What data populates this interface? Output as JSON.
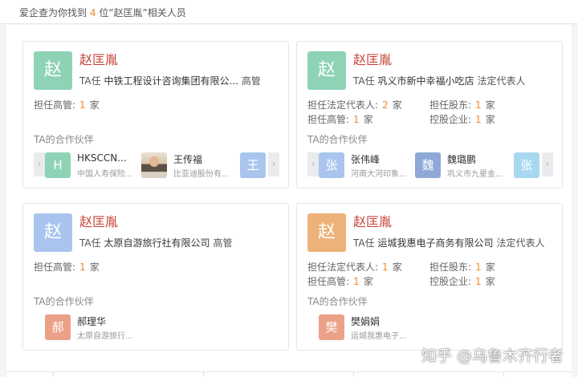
{
  "header": {
    "prefix": "爱企查为你找到",
    "count": "4",
    "suffix": "位“赵匡胤”相关人员"
  },
  "colors": {
    "accent_name": "#c7463b",
    "count_orange": "#f0892f",
    "avatar_teal": "#8ed3b6",
    "avatar_blue": "#a9c5ee",
    "avatar_orange": "#edb27a",
    "avatar_salmon": "#eba187",
    "avatar_steelblue": "#8ea9d6",
    "avatar_cyan": "#a7d8f0"
  },
  "cards": [
    {
      "avatar_char": "赵",
      "name": "赵匡胤",
      "role_prefix": "TA任",
      "company": "中铁工程设计咨询集团有限公...",
      "tag": "高管",
      "stats": [
        {
          "label": "担任高管:",
          "count": "1",
          "unit": "家"
        }
      ],
      "partner_title": "TA的合作伙伴",
      "has_arrows": true,
      "partners": [
        {
          "avatar_char": "H",
          "name": "HKSCCN...",
          "company": "中国人寿保险..."
        },
        {
          "avatar_char": "",
          "name": "王传福",
          "company": "比亚迪股份有..."
        }
      ],
      "partial_char": "王"
    },
    {
      "avatar_char": "赵",
      "name": "赵匡胤",
      "role_prefix": "TA任",
      "company": "巩义市新中幸福小吃店",
      "tag": "法定代表人",
      "stats": [
        {
          "label": "担任法定代表人:",
          "count": "2",
          "unit": "家"
        },
        {
          "label": "担任股东:",
          "count": "1",
          "unit": "家"
        },
        {
          "label": "担任高管:",
          "count": "1",
          "unit": "家"
        },
        {
          "label": "控股企业:",
          "count": "1",
          "unit": "家"
        }
      ],
      "partner_title": "TA的合作伙伴",
      "has_arrows": true,
      "partners": [
        {
          "avatar_char": "张",
          "name": "张伟峰",
          "company": "河南大河印象..."
        },
        {
          "avatar_char": "魏",
          "name": "魏璐鹏",
          "company": "巩义市九星金..."
        }
      ],
      "partial_char": "张"
    },
    {
      "avatar_char": "赵",
      "name": "赵匡胤",
      "role_prefix": "TA任",
      "company": "太原自游旅行社有限公司",
      "tag": "高管",
      "stats": [
        {
          "label": "担任高管:",
          "count": "1",
          "unit": "家"
        }
      ],
      "partner_title": "TA的合作伙伴",
      "has_arrows": false,
      "partners": [
        {
          "avatar_char": "郝",
          "name": "郝理华",
          "company": "太原自游旅行..."
        }
      ]
    },
    {
      "avatar_char": "赵",
      "name": "赵匡胤",
      "role_prefix": "TA任",
      "company": "运城我惠电子商务有限公司",
      "tag": "法定代表人",
      "stats": [
        {
          "label": "担任法定代表人:",
          "count": "1",
          "unit": "家"
        },
        {
          "label": "担任股东:",
          "count": "1",
          "unit": "家"
        },
        {
          "label": "担任高管:",
          "count": "1",
          "unit": "家"
        },
        {
          "label": "控股企业:",
          "count": "1",
          "unit": "家"
        }
      ],
      "partner_title": "TA的合作伙伴",
      "has_arrows": false,
      "partners": [
        {
          "avatar_char": "樊",
          "name": "樊娟娟",
          "company": "运城我惠电子..."
        }
      ]
    }
  ],
  "icons": {
    "left_arrow": "chevron-left-icon",
    "right_arrow": "chevron-right-icon"
  },
  "arrows": {
    "left": "‹",
    "right": "›"
  },
  "watermark": "知乎 @乌鲁木齐行者"
}
